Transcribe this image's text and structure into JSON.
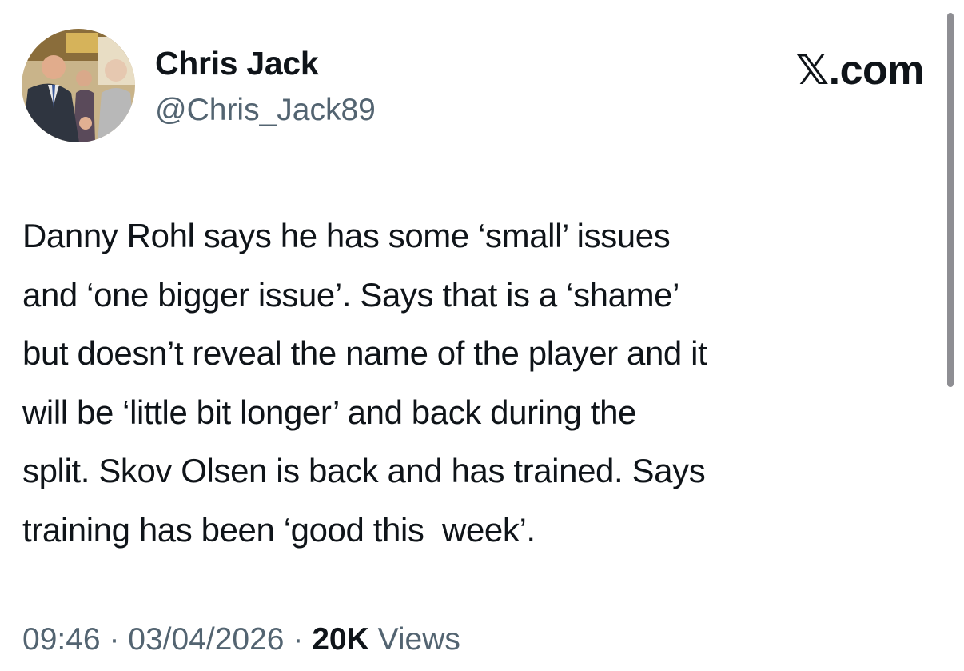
{
  "author": {
    "display_name": "Chris Jack",
    "handle": "@Chris_Jack89",
    "avatar": "profile-photo-avatar"
  },
  "brand": {
    "mark": "𝕏",
    "suffix": ".com"
  },
  "tweet": {
    "text": "Danny Rohl says he has some ‘small’ issues\nand ‘one bigger issue’. Says that is a ‘shame’\nbut doesn’t reveal the name of the player and it\nwill be ‘little bit longer’ and back during the\nsplit. Skov Olsen is back and has trained. Says\ntraining has been ‘good this  week’."
  },
  "meta": {
    "time": "09:46",
    "date": "03/04/2026",
    "separator": "·",
    "views_count": "20K",
    "views_label": "Views"
  },
  "colors": {
    "text": "#0f1419",
    "secondary": "#536471",
    "scrollbar": "#8e8e93"
  }
}
